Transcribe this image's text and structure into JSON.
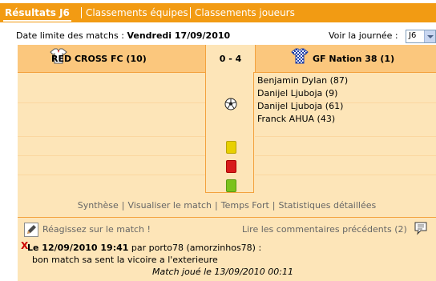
{
  "tabs": [
    {
      "label": "Résultats J6",
      "active": true
    },
    {
      "label": "Classements équipes",
      "active": false
    },
    {
      "label": "Classements joueurs",
      "active": false
    }
  ],
  "info": {
    "deadline_label": "Date limite des matchs :",
    "deadline_value": "Vendredi 17/09/2010",
    "journee_label": "Voir la journée :",
    "journee_selected": "J6"
  },
  "match": {
    "home_team": "RED CROSS FC (10)",
    "away_team": "GF Nation 38 (1)",
    "score": "0 - 4",
    "scorers": [
      "Benjamin Dylan (87)",
      "Danijel Ljuboja (9)",
      "Danijel Ljuboja (61)",
      "Franck AHUA (43)"
    ]
  },
  "links": [
    "Synthèse",
    "Visualiser le match",
    "Temps Fort",
    "Statistiques détaillées"
  ],
  "actions": {
    "react_label": "Réagissez sur le match !",
    "comments_link": "Lire les commentaires précédents (2)"
  },
  "comment": {
    "delete_symbol": "X",
    "date": "Le 12/09/2010 19:41",
    "author_prefix": "par",
    "author": "porto78 (amorzinhos78) :",
    "text": "bon match sa sent la vicoire a l'exterieure"
  },
  "footer": "Match joué le 13/09/2010 00:11",
  "colors": {
    "accent": "#f29b13",
    "panel": "#fde5b8",
    "header": "#fbc77d"
  },
  "icons": [
    "jersey-home-icon",
    "jersey-away-icon",
    "ball-icon",
    "yellow-card-icon",
    "red-card-icon",
    "green-card-icon",
    "pencil-icon",
    "comment-bubble-icon"
  ]
}
